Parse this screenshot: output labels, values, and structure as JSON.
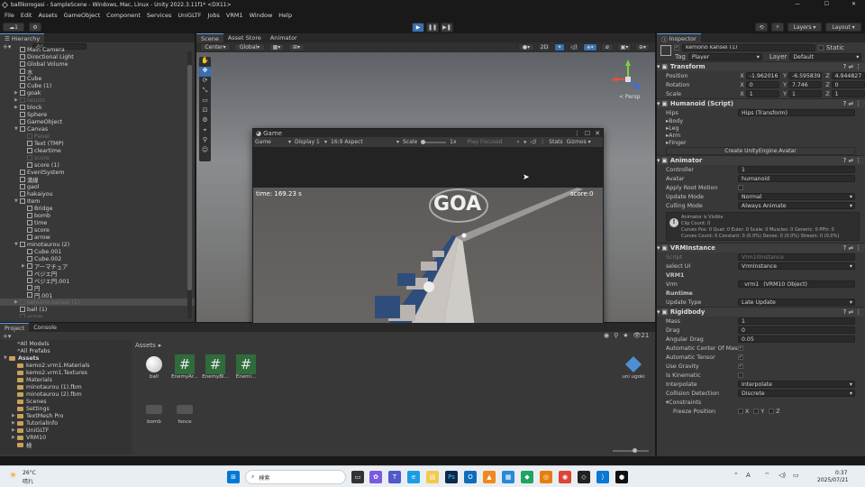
{
  "window": {
    "title": "balllkorogasi - SampleScene - Windows, Mac, Linux - Unity 2022.3.11f1* <DX11>",
    "minimize": "—",
    "maximize": "☐",
    "close": "✕"
  },
  "menu": [
    "File",
    "Edit",
    "Assets",
    "GameObject",
    "Component",
    "Services",
    "UniGLTF",
    "Jobs",
    "VRM1",
    "Window",
    "Help"
  ],
  "toolbar": {
    "account": "1",
    "layers": "Layers",
    "layout": "Layout",
    "play_icon": "play-icon",
    "pause_icon": "pause-icon",
    "step_icon": "step-icon"
  },
  "hierarchy": {
    "tab": "Hierarchy",
    "search_placeholder": "All",
    "items": [
      {
        "label": "Main Camera",
        "indent": 2,
        "dim": false
      },
      {
        "label": "Directional Light",
        "indent": 2,
        "dim": false
      },
      {
        "label": "Global Volume",
        "indent": 2,
        "dim": false
      },
      {
        "label": "水",
        "indent": 2,
        "dim": false
      },
      {
        "label": "Cube",
        "indent": 2,
        "dim": false
      },
      {
        "label": "Cube (1)",
        "indent": 2,
        "dim": false
      },
      {
        "label": "goak",
        "indent": 2,
        "dim": false,
        "arrow": "▶"
      },
      {
        "label": "tesuto",
        "indent": 2,
        "dim": true,
        "arrow": "▶"
      },
      {
        "label": "block",
        "indent": 2,
        "dim": false,
        "arrow": "▶"
      },
      {
        "label": "Sphere",
        "indent": 2,
        "dim": false
      },
      {
        "label": "GameObject",
        "indent": 2,
        "dim": false
      },
      {
        "label": "Canvas",
        "indent": 2,
        "dim": false,
        "arrow": "▼"
      },
      {
        "label": "Panel",
        "indent": 3,
        "dim": true
      },
      {
        "label": "Text (TMP)",
        "indent": 3,
        "dim": false
      },
      {
        "label": "cleartime",
        "indent": 3,
        "dim": false
      },
      {
        "label": "score",
        "indent": 3,
        "dim": true
      },
      {
        "label": "score (1)",
        "indent": 3,
        "dim": false
      },
      {
        "label": "EventSystem",
        "indent": 2,
        "dim": false
      },
      {
        "label": "満線",
        "indent": 2,
        "dim": false
      },
      {
        "label": "gaol",
        "indent": 2,
        "dim": false
      },
      {
        "label": "hakaiyou",
        "indent": 2,
        "dim": false
      },
      {
        "label": "Item",
        "indent": 2,
        "dim": false,
        "arrow": "▼"
      },
      {
        "label": "Bridge",
        "indent": 3,
        "dim": false
      },
      {
        "label": "bomb",
        "indent": 3,
        "dim": false
      },
      {
        "label": "time",
        "indent": 3,
        "dim": false
      },
      {
        "label": "score",
        "indent": 3,
        "dim": false
      },
      {
        "label": "arrow",
        "indent": 3,
        "dim": false
      },
      {
        "label": "minotaurou (2)",
        "indent": 2,
        "dim": false,
        "arrow": "▼"
      },
      {
        "label": "Cube.001",
        "indent": 3,
        "dim": false
      },
      {
        "label": "Cube.002",
        "indent": 3,
        "dim": false
      },
      {
        "label": "アーマチュア",
        "indent": 3,
        "dim": false,
        "arrow": "▶"
      },
      {
        "label": "ベジエ円",
        "indent": 3,
        "dim": false
      },
      {
        "label": "ベジエ円.001",
        "indent": 3,
        "dim": false
      },
      {
        "label": "円",
        "indent": 3,
        "dim": false
      },
      {
        "label": "円.001",
        "indent": 3,
        "dim": false
      },
      {
        "label": "kemono kansei (1)",
        "indent": 2,
        "dim": true,
        "selected": true,
        "arrow": "▶"
      },
      {
        "label": "ball (1)",
        "indent": 2,
        "dim": false
      },
      {
        "label": "arrow",
        "indent": 2,
        "dim": true
      }
    ]
  },
  "scene": {
    "tabs": [
      "Scene",
      "Asset Store",
      "Animator"
    ],
    "pivot": "Center",
    "space": "Global",
    "mode_2d": "2D",
    "persp": "< Persp"
  },
  "game": {
    "tab": "Game",
    "display_mode": "Game",
    "display": "Display 1",
    "aspect": "16:9 Aspect",
    "scale_label": "Scale",
    "scale_value": "1x",
    "play_focused": "Play Focused",
    "stats": "Stats",
    "gizmos": "Gizmos",
    "time_text": "time: 169.23 s",
    "score_text": "score:0"
  },
  "project": {
    "tabs": [
      "Project",
      "Console"
    ],
    "tree": [
      {
        "label": "All Models",
        "indent": 1,
        "type": "search"
      },
      {
        "label": "All Prefabs",
        "indent": 1,
        "type": "search"
      },
      {
        "label": "Assets",
        "indent": 0,
        "type": "folder",
        "bold": true,
        "arrow": "▼"
      },
      {
        "label": "kemo2.vrm1.Materials",
        "indent": 1,
        "type": "folder"
      },
      {
        "label": "kemo2.vrm1.Textures",
        "indent": 1,
        "type": "folder"
      },
      {
        "label": "Materials",
        "indent": 1,
        "type": "folder"
      },
      {
        "label": "minotaurou (1).fbm",
        "indent": 1,
        "type": "folder"
      },
      {
        "label": "minotaurou (2).fbm",
        "indent": 1,
        "type": "folder"
      },
      {
        "label": "Scenes",
        "indent": 1,
        "type": "folder"
      },
      {
        "label": "Settings",
        "indent": 1,
        "type": "folder"
      },
      {
        "label": "TextMesh Pro",
        "indent": 1,
        "type": "folder",
        "arrow": "▶"
      },
      {
        "label": "TutorialInfo",
        "indent": 1,
        "type": "folder",
        "arrow": "▶"
      },
      {
        "label": "UniGLTF",
        "indent": 1,
        "type": "folder",
        "arrow": "▶"
      },
      {
        "label": "VRM10",
        "indent": 1,
        "type": "folder",
        "arrow": "▶"
      },
      {
        "label": "検",
        "indent": 1,
        "type": "folder"
      }
    ],
    "breadcrumb": "Assets",
    "assets": [
      "ball",
      "EnemyAr...",
      "EnemyBl...",
      "Enemi...",
      "bomb",
      "fence",
      "uni ugoki"
    ],
    "count": "21"
  },
  "inspector": {
    "tab": "Inspector",
    "object_name": "kemono kansei (1)",
    "static": "Static",
    "tag_label": "Tag",
    "tag": "Player",
    "layer_label": "Layer",
    "layer": "Default",
    "transform": {
      "title": "Transform",
      "position_label": "Position",
      "px": "-1.962016",
      "py": "-6.595839",
      "pz": "4.944827",
      "rotation_label": "Rotation",
      "rx": "0",
      "ry": "7.746",
      "rz": "0",
      "scale_label": "Scale",
      "sx": "1",
      "sy": "1",
      "sz": "1"
    },
    "humanoid": {
      "title": "Humanoid (Script)",
      "hips_label": "Hips",
      "hips": "Hips (Transform)",
      "items": [
        "Body",
        "Leg",
        "Arm",
        "Finger"
      ],
      "create_btn": "Create UnityEngine.Avatar"
    },
    "animator": {
      "title": "Animator",
      "rows": [
        {
          "label": "Controller",
          "value": "1",
          "kind": "field"
        },
        {
          "label": "Avatar",
          "value": "humanoid",
          "kind": "field"
        },
        {
          "label": "Apply Root Motion",
          "value": "",
          "kind": "check"
        },
        {
          "label": "Update Mode",
          "value": "Normal",
          "kind": "dropdown"
        },
        {
          "label": "Culling Mode",
          "value": "Always Animate",
          "kind": "dropdown"
        }
      ],
      "info": [
        "Animator is Visible",
        "Clip Count: 0",
        "Curves Pos: 0 Quat: 0 Euler: 0 Scale: 0 Muscles: 0 Generic: 0 PPtr: 0",
        "Curves Count: 0 Constant: 0 (0.0%) Dense: 0 (0.0%) Stream: 0 (0.0%)"
      ]
    },
    "vrm": {
      "title": "VRMInstance",
      "script_label": "Script",
      "script": "Vrm10Instance",
      "select_label": "select UI",
      "select": "VrmInstance",
      "section": "VRM1",
      "vrm_label": "Vrm",
      "vrm": "_vrm1_ (VRM10 Object)",
      "runtime": "Runtime",
      "update_label": "Update Type",
      "update": "Late Update"
    },
    "rigidbody": {
      "title": "Rigidbody",
      "rows": [
        {
          "label": "Mass",
          "value": "1",
          "kind": "field"
        },
        {
          "label": "Drag",
          "value": "0",
          "kind": "field"
        },
        {
          "label": "Angular Drag",
          "value": "0.05",
          "kind": "field"
        },
        {
          "label": "Automatic Center Of Mass",
          "value": "✓",
          "kind": "check"
        },
        {
          "label": "Automatic Tensor",
          "value": "✓",
          "kind": "check"
        },
        {
          "label": "Use Gravity",
          "value": "✓",
          "kind": "check"
        },
        {
          "label": "Is Kinematic",
          "value": "",
          "kind": "check"
        },
        {
          "label": "Interpolate",
          "value": "Interpolate",
          "kind": "dropdown"
        },
        {
          "label": "Collision Detection",
          "value": "Discrete",
          "kind": "dropdown"
        }
      ],
      "constraints": "Constraints",
      "freeze_label": "Freeze Position",
      "x": "X",
      "y": "Y",
      "z": "Z"
    }
  },
  "taskbar": {
    "temp": "26°C",
    "weather": "晴れ",
    "search": "検索",
    "ime": "A",
    "time": "0:37",
    "date": "2025/07/21",
    "colors": {
      "accent": "#0078d4",
      "unity_play": "#3a6fb0"
    }
  }
}
